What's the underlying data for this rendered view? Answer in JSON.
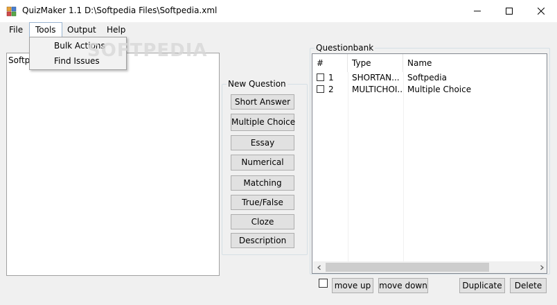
{
  "window": {
    "app_name": "QuizMaker 1.1",
    "file_path": "D:\\Softpedia Files\\Softpedia.xml",
    "title": "QuizMaker 1.1   D:\\Softpedia Files\\Softpedia.xml"
  },
  "menu": {
    "file": "File",
    "tools": "Tools",
    "output": "Output",
    "help": "Help"
  },
  "tools_menu": {
    "items": [
      {
        "label": "Bulk Actions"
      },
      {
        "label": "Find Issues"
      }
    ]
  },
  "watermark": "SOFTPEDIA",
  "left_panel": {
    "items": [
      "Softpedia"
    ]
  },
  "new_question": {
    "title": "New Question",
    "buttons": [
      {
        "label": "Short Answer"
      },
      {
        "label": "Multiple Choice"
      },
      {
        "label": "Essay"
      },
      {
        "label": "Numerical"
      },
      {
        "label": "Matching"
      },
      {
        "label": "True/False"
      },
      {
        "label": "Cloze"
      },
      {
        "label": "Description"
      }
    ]
  },
  "questionbank": {
    "title": "Questionbank",
    "columns": {
      "num": "#",
      "type": "Type",
      "name": "Name"
    },
    "rows": [
      {
        "num": "1",
        "type": "SHORTAN...",
        "name": "Softpedia",
        "checked": false
      },
      {
        "num": "2",
        "type": "MULTICHOI...",
        "name": "Multiple Choice",
        "checked": false
      }
    ]
  },
  "bottom": {
    "move_up": "move up",
    "move_down": "move down",
    "duplicate": "Duplicate",
    "delete": "Delete"
  },
  "colors": {
    "window_bg": "#f0f0f0",
    "button_bg": "#e1e1e1",
    "menu_highlight_border": "#99b4d1"
  }
}
